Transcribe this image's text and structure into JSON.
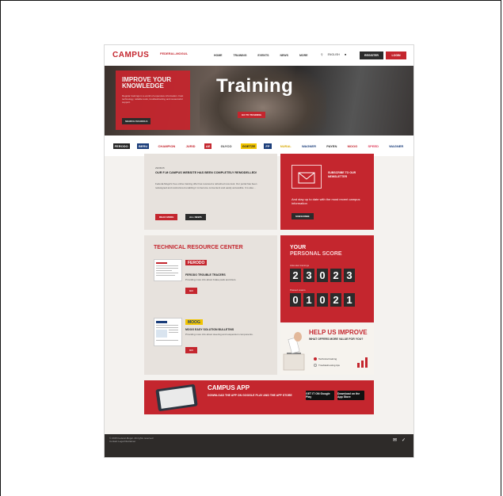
{
  "nav": {
    "logo": "CAMPUS",
    "fm_logo": "FEDERAL-MOGUL",
    "links": [
      "HOME",
      "TRAINING",
      "EVENTS",
      "NEWS",
      "MORE"
    ],
    "language": "ENGLISH",
    "register": "REGISTER",
    "login": "LOGIN"
  },
  "hero": {
    "box_title": "IMPROVE YOUR KNOWLEDGE",
    "box_text": "Regular trainings in a world of expensive information. Fast technology, reliable tools, troubleshooting and resourceful support.",
    "box_button": "SEARCH SCHOOLS",
    "title": "Training",
    "button": "GO TO TRAINING"
  },
  "brands": [
    "FERODO",
    "BERU",
    "CHAMPION",
    "JURID",
    "AE",
    "GLYCO",
    "GOETZE",
    "FP",
    "NURAL",
    "WAGNER",
    "PAYEN",
    "MOOG",
    "SPEED",
    "WAGNER"
  ],
  "news": {
    "date": "29/08/15",
    "title": "OUR F-M CAMPUS WEBSITE HAS BEEN COMPLETELY REMODELLED!",
    "text": "Federal-Mogul's free online training offer has received a refreshed new look. Our portal has been redesigned and restructured enabling it to become convenient and easily accessible. It is also...",
    "read_more": "READ MORE",
    "all_news": "ALL NEWS"
  },
  "newsletter": {
    "title": "SUBSCRIBE TO OUR NEWSLETTER",
    "text": "And stay up to date with the most recent campus information",
    "button": "SUBSCRIBE"
  },
  "trc": {
    "title": "TECHNICAL RESOURCE CENTER",
    "item1_badge": "FERODO",
    "item1_title": "FERODO TROUBLE TRACERS",
    "item1_text": "Providing more info about brake pads and discs.",
    "item1_btn": "GO",
    "item2_badge": "MOOG",
    "item2_title": "MOOG EASY SOLUTION BULLETINS",
    "item2_text": "Providing more info about steering and suspension components.",
    "item2_btn": "GO"
  },
  "score": {
    "title1": "YOUR",
    "title2": "PERSONAL SCORE",
    "label1": "Attended trainings",
    "digits1": [
      "2",
      "3",
      "0",
      "2",
      "3"
    ],
    "label2": "Passed exams",
    "digits2": [
      "0",
      "1",
      "0",
      "2",
      "1"
    ]
  },
  "improve": {
    "title": "HELP US IMPROVE",
    "subtitle": "WHAT OFFERS MORE VALUE FOR YOU?",
    "opt1": "Technical training",
    "opt2": "Troubleshooting tips"
  },
  "app": {
    "title": "CAMPUS APP",
    "subtitle": "DOWNLOAD THE APP ON GOOGLE PLAY AND THE APP STORE",
    "google": "GET IT ON Google Play",
    "apple": "Download on the App Store"
  },
  "footer": {
    "copyright": "© 2015 Federal-Mogul. All rights reserved",
    "links": "Contact Legal Disclaimer"
  },
  "colors": {
    "accent": "#c4262e",
    "dark": "#2b2b2b"
  }
}
